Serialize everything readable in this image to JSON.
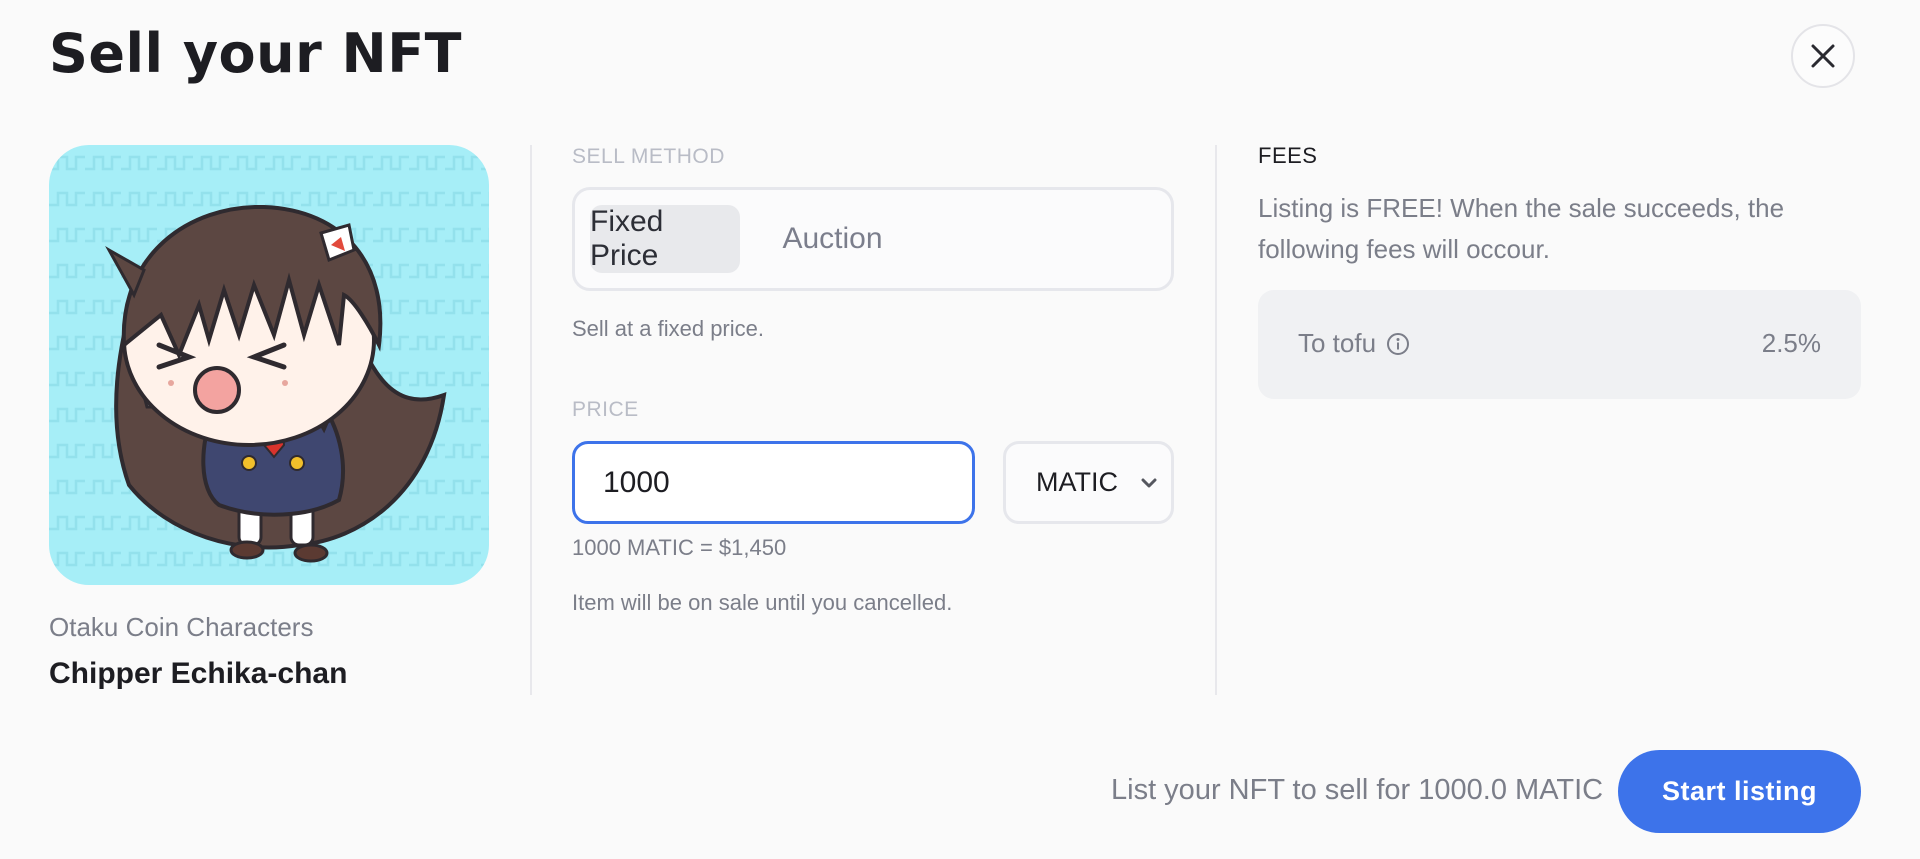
{
  "header": {
    "title": "Sell your NFT",
    "close_icon": "close-icon"
  },
  "nft": {
    "collection": "Otaku Coin Characters",
    "name": "Chipper Echika-chan",
    "image_background": "#a6eef7"
  },
  "sell_method": {
    "label": "SELL METHOD",
    "options": [
      "Fixed Price",
      "Auction"
    ],
    "selected": "Fixed Price",
    "helper": "Sell at a fixed price."
  },
  "price": {
    "label": "PRICE",
    "value": "1000",
    "currency": "MATIC",
    "conversion": "1000 MATIC = $1,450",
    "duration_note": "Item will be on sale until you cancelled."
  },
  "fees": {
    "title": "FEES",
    "description": "Listing is FREE! When the sale succeeds, the following fees will occour.",
    "items": [
      {
        "label": "To tofu",
        "value": "2.5%",
        "icon": "info-icon"
      }
    ]
  },
  "footer": {
    "summary": "List your NFT to sell for 1000.0 MATIC",
    "cta": "Start listing"
  },
  "colors": {
    "accent": "#3d73ea",
    "background": "#fafafa",
    "muted_text": "#7b7e89"
  }
}
